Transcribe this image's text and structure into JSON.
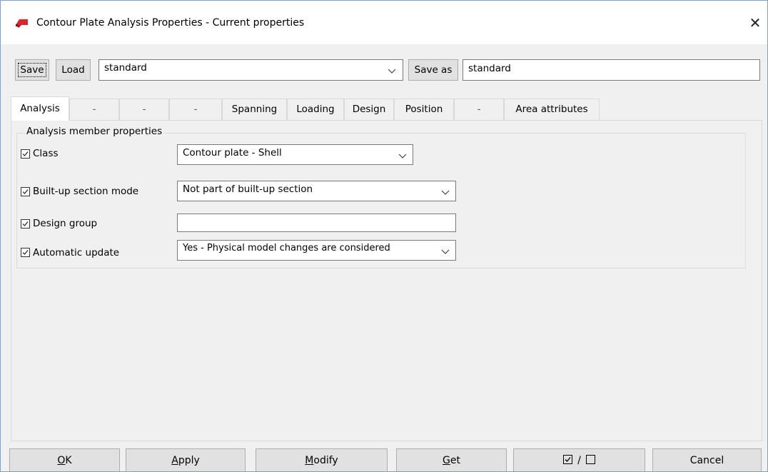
{
  "window": {
    "title": "Contour Plate Analysis Properties - Current properties",
    "close_glyph": "✕"
  },
  "toolbar": {
    "save_label": "Save",
    "load_label": "Load",
    "preset_value": "standard",
    "save_as_label": "Save as",
    "save_as_value": "standard"
  },
  "tabs": [
    {
      "label": "Analysis",
      "active": true
    },
    {
      "label": "-"
    },
    {
      "label": "-"
    },
    {
      "label": "-"
    },
    {
      "label": "Spanning"
    },
    {
      "label": "Loading"
    },
    {
      "label": "Design"
    },
    {
      "label": "Position"
    },
    {
      "label": "-"
    },
    {
      "label": "Area attributes"
    }
  ],
  "group": {
    "title": "Analysis member properties",
    "rows": [
      {
        "label": "Class",
        "checked": true,
        "type": "select",
        "value": "Contour plate - Shell"
      },
      {
        "label": "Built-up section mode",
        "checked": true,
        "type": "select",
        "value": "Not part of built-up section"
      },
      {
        "label": "Design group",
        "checked": true,
        "type": "text",
        "value": ""
      },
      {
        "label": "Automatic update",
        "checked": true,
        "type": "select",
        "value": "Yes - Physical model changes are considered"
      }
    ]
  },
  "buttons": {
    "ok": {
      "first": "O",
      "rest": "K"
    },
    "apply": {
      "first": "A",
      "rest": "pply"
    },
    "modify": {
      "first": "M",
      "rest": "odify"
    },
    "get": {
      "first": "G",
      "rest": "et"
    },
    "toggle_all": {
      "label": "/"
    },
    "cancel": {
      "label": "Cancel"
    }
  },
  "colors": {
    "accent_icon": "#d9262c",
    "window_border": "#7a9fd0"
  },
  "icons": [
    "app-logo-icon",
    "close-icon",
    "chevron-down-icon",
    "checkbox-checked-icon",
    "checkbox-empty-icon"
  ]
}
